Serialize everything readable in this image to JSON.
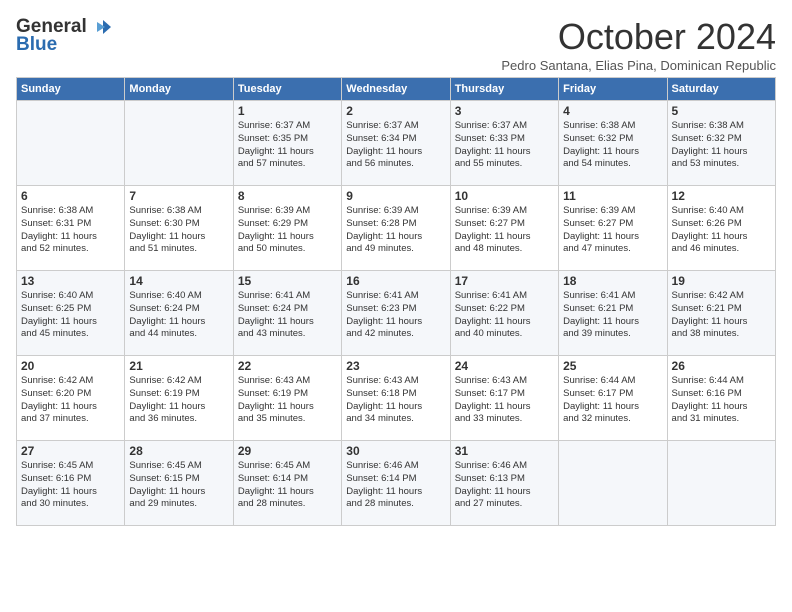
{
  "logo": {
    "general": "General",
    "blue": "Blue"
  },
  "header": {
    "month": "October 2024",
    "location": "Pedro Santana, Elias Pina, Dominican Republic"
  },
  "weekdays": [
    "Sunday",
    "Monday",
    "Tuesday",
    "Wednesday",
    "Thursday",
    "Friday",
    "Saturday"
  ],
  "weeks": [
    [
      {
        "day": "",
        "sunrise": "",
        "sunset": "",
        "daylight": ""
      },
      {
        "day": "",
        "sunrise": "",
        "sunset": "",
        "daylight": ""
      },
      {
        "day": "1",
        "sunrise": "Sunrise: 6:37 AM",
        "sunset": "Sunset: 6:35 PM",
        "daylight": "Daylight: 11 hours and 57 minutes."
      },
      {
        "day": "2",
        "sunrise": "Sunrise: 6:37 AM",
        "sunset": "Sunset: 6:34 PM",
        "daylight": "Daylight: 11 hours and 56 minutes."
      },
      {
        "day": "3",
        "sunrise": "Sunrise: 6:37 AM",
        "sunset": "Sunset: 6:33 PM",
        "daylight": "Daylight: 11 hours and 55 minutes."
      },
      {
        "day": "4",
        "sunrise": "Sunrise: 6:38 AM",
        "sunset": "Sunset: 6:32 PM",
        "daylight": "Daylight: 11 hours and 54 minutes."
      },
      {
        "day": "5",
        "sunrise": "Sunrise: 6:38 AM",
        "sunset": "Sunset: 6:32 PM",
        "daylight": "Daylight: 11 hours and 53 minutes."
      }
    ],
    [
      {
        "day": "6",
        "sunrise": "Sunrise: 6:38 AM",
        "sunset": "Sunset: 6:31 PM",
        "daylight": "Daylight: 11 hours and 52 minutes."
      },
      {
        "day": "7",
        "sunrise": "Sunrise: 6:38 AM",
        "sunset": "Sunset: 6:30 PM",
        "daylight": "Daylight: 11 hours and 51 minutes."
      },
      {
        "day": "8",
        "sunrise": "Sunrise: 6:39 AM",
        "sunset": "Sunset: 6:29 PM",
        "daylight": "Daylight: 11 hours and 50 minutes."
      },
      {
        "day": "9",
        "sunrise": "Sunrise: 6:39 AM",
        "sunset": "Sunset: 6:28 PM",
        "daylight": "Daylight: 11 hours and 49 minutes."
      },
      {
        "day": "10",
        "sunrise": "Sunrise: 6:39 AM",
        "sunset": "Sunset: 6:27 PM",
        "daylight": "Daylight: 11 hours and 48 minutes."
      },
      {
        "day": "11",
        "sunrise": "Sunrise: 6:39 AM",
        "sunset": "Sunset: 6:27 PM",
        "daylight": "Daylight: 11 hours and 47 minutes."
      },
      {
        "day": "12",
        "sunrise": "Sunrise: 6:40 AM",
        "sunset": "Sunset: 6:26 PM",
        "daylight": "Daylight: 11 hours and 46 minutes."
      }
    ],
    [
      {
        "day": "13",
        "sunrise": "Sunrise: 6:40 AM",
        "sunset": "Sunset: 6:25 PM",
        "daylight": "Daylight: 11 hours and 45 minutes."
      },
      {
        "day": "14",
        "sunrise": "Sunrise: 6:40 AM",
        "sunset": "Sunset: 6:24 PM",
        "daylight": "Daylight: 11 hours and 44 minutes."
      },
      {
        "day": "15",
        "sunrise": "Sunrise: 6:41 AM",
        "sunset": "Sunset: 6:24 PM",
        "daylight": "Daylight: 11 hours and 43 minutes."
      },
      {
        "day": "16",
        "sunrise": "Sunrise: 6:41 AM",
        "sunset": "Sunset: 6:23 PM",
        "daylight": "Daylight: 11 hours and 42 minutes."
      },
      {
        "day": "17",
        "sunrise": "Sunrise: 6:41 AM",
        "sunset": "Sunset: 6:22 PM",
        "daylight": "Daylight: 11 hours and 40 minutes."
      },
      {
        "day": "18",
        "sunrise": "Sunrise: 6:41 AM",
        "sunset": "Sunset: 6:21 PM",
        "daylight": "Daylight: 11 hours and 39 minutes."
      },
      {
        "day": "19",
        "sunrise": "Sunrise: 6:42 AM",
        "sunset": "Sunset: 6:21 PM",
        "daylight": "Daylight: 11 hours and 38 minutes."
      }
    ],
    [
      {
        "day": "20",
        "sunrise": "Sunrise: 6:42 AM",
        "sunset": "Sunset: 6:20 PM",
        "daylight": "Daylight: 11 hours and 37 minutes."
      },
      {
        "day": "21",
        "sunrise": "Sunrise: 6:42 AM",
        "sunset": "Sunset: 6:19 PM",
        "daylight": "Daylight: 11 hours and 36 minutes."
      },
      {
        "day": "22",
        "sunrise": "Sunrise: 6:43 AM",
        "sunset": "Sunset: 6:19 PM",
        "daylight": "Daylight: 11 hours and 35 minutes."
      },
      {
        "day": "23",
        "sunrise": "Sunrise: 6:43 AM",
        "sunset": "Sunset: 6:18 PM",
        "daylight": "Daylight: 11 hours and 34 minutes."
      },
      {
        "day": "24",
        "sunrise": "Sunrise: 6:43 AM",
        "sunset": "Sunset: 6:17 PM",
        "daylight": "Daylight: 11 hours and 33 minutes."
      },
      {
        "day": "25",
        "sunrise": "Sunrise: 6:44 AM",
        "sunset": "Sunset: 6:17 PM",
        "daylight": "Daylight: 11 hours and 32 minutes."
      },
      {
        "day": "26",
        "sunrise": "Sunrise: 6:44 AM",
        "sunset": "Sunset: 6:16 PM",
        "daylight": "Daylight: 11 hours and 31 minutes."
      }
    ],
    [
      {
        "day": "27",
        "sunrise": "Sunrise: 6:45 AM",
        "sunset": "Sunset: 6:16 PM",
        "daylight": "Daylight: 11 hours and 30 minutes."
      },
      {
        "day": "28",
        "sunrise": "Sunrise: 6:45 AM",
        "sunset": "Sunset: 6:15 PM",
        "daylight": "Daylight: 11 hours and 29 minutes."
      },
      {
        "day": "29",
        "sunrise": "Sunrise: 6:45 AM",
        "sunset": "Sunset: 6:14 PM",
        "daylight": "Daylight: 11 hours and 28 minutes."
      },
      {
        "day": "30",
        "sunrise": "Sunrise: 6:46 AM",
        "sunset": "Sunset: 6:14 PM",
        "daylight": "Daylight: 11 hours and 28 minutes."
      },
      {
        "day": "31",
        "sunrise": "Sunrise: 6:46 AM",
        "sunset": "Sunset: 6:13 PM",
        "daylight": "Daylight: 11 hours and 27 minutes."
      },
      {
        "day": "",
        "sunrise": "",
        "sunset": "",
        "daylight": ""
      },
      {
        "day": "",
        "sunrise": "",
        "sunset": "",
        "daylight": ""
      }
    ]
  ]
}
